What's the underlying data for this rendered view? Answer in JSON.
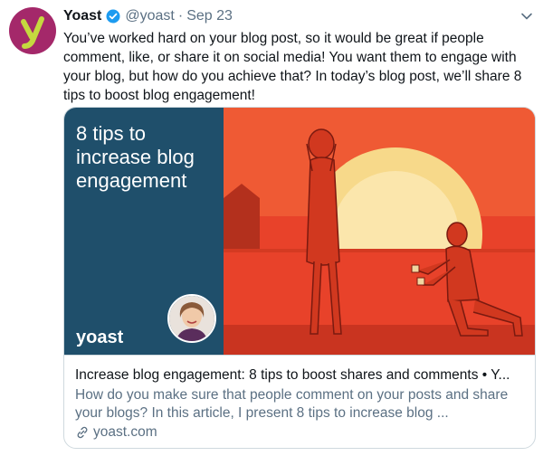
{
  "tweet": {
    "author_name": "Yoast",
    "handle": "@yoast",
    "separator": "·",
    "date": "Sep 23",
    "text": "You’ve worked hard on your blog post, so it would be great if people comment, like, or share it on social media! You want them to engage with your blog, but how do you achieve that? In today’s blog post, we’ll share 8 tips to boost blog engagement!",
    "avatar_icon": "yoast-logo-icon",
    "verified_icon": "verified-badge-icon",
    "menu_icon": "chevron-down-icon"
  },
  "card": {
    "image": {
      "headline": "8 tips to increase blog engagement",
      "logo_text": "yoast"
    },
    "title": "Increase blog engagement: 8 tips to boost shares and comments • Y...",
    "description": "How do you make sure that people comment on your posts and share your blogs? In this article, I present 8 tips to increase blog ...",
    "domain": "yoast.com",
    "link_icon": "link-icon"
  },
  "colors": {
    "brand": "#a4286a",
    "verified": "#1d9bf0",
    "image_panel": "#1f4f6b",
    "sunset_red": "#e8422a",
    "sun": "#f7d98a"
  }
}
